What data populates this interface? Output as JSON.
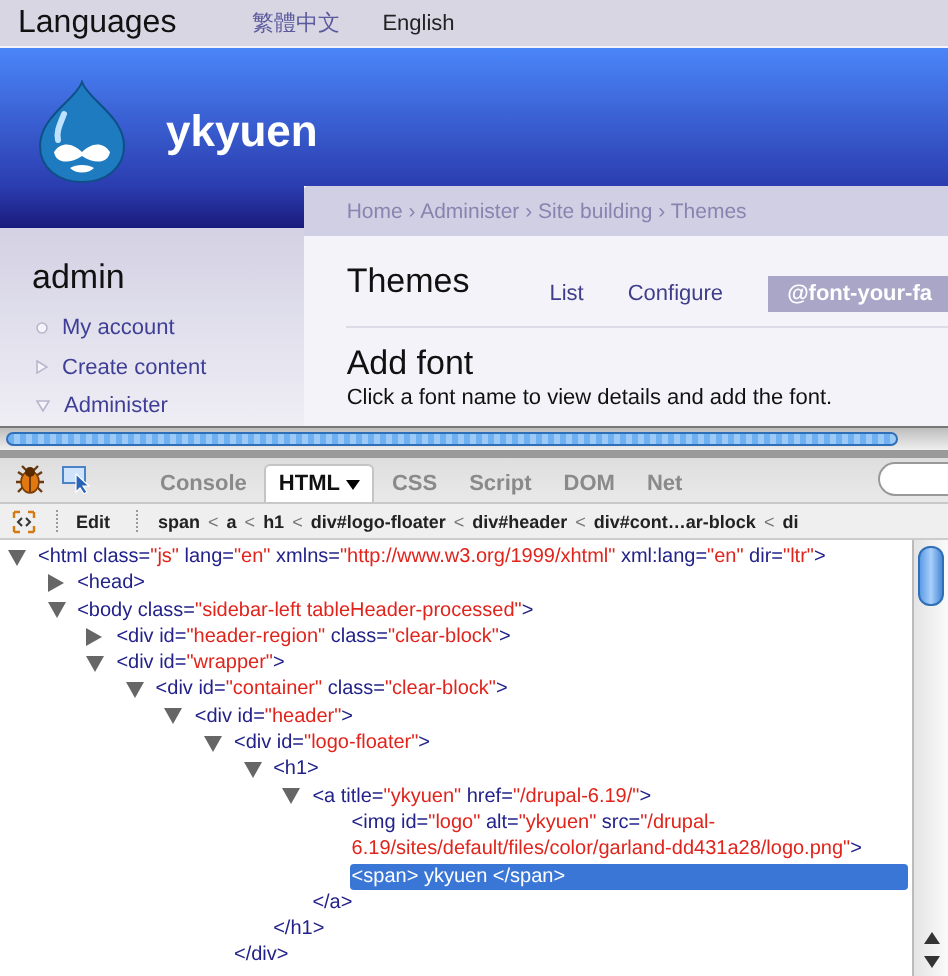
{
  "language_bar": {
    "title": "Languages",
    "links": [
      {
        "label": "繁體中文",
        "selected": false
      },
      {
        "label": "English",
        "selected": true
      }
    ]
  },
  "site": {
    "name": "ykyuen"
  },
  "breadcrumb": "Home › Administer › Site building › Themes",
  "sidebar": {
    "title": "admin",
    "items": [
      {
        "label": "My account",
        "kind": "leaf"
      },
      {
        "label": "Create content",
        "kind": "collapsed"
      },
      {
        "label": "Administer",
        "kind": "expanded"
      }
    ]
  },
  "content": {
    "title": "Themes",
    "tabs": [
      {
        "label": "List",
        "selected": false
      },
      {
        "label": "Configure",
        "selected": false
      },
      {
        "label": "@font-your-fa",
        "selected": true
      }
    ],
    "heading": "Add font",
    "description": "Click a font name to view details and add the font."
  },
  "devtools": {
    "tabs": [
      {
        "label": "Console",
        "selected": false
      },
      {
        "label": "HTML",
        "selected": true
      },
      {
        "label": "CSS",
        "selected": false
      },
      {
        "label": "Script",
        "selected": false
      },
      {
        "label": "DOM",
        "selected": false
      },
      {
        "label": "Net",
        "selected": false
      }
    ],
    "edit_label": "Edit",
    "path": [
      {
        "label": "span",
        "kind": "node"
      },
      {
        "label": "<",
        "kind": "sep"
      },
      {
        "label": "a",
        "kind": "node"
      },
      {
        "label": "<",
        "kind": "sep"
      },
      {
        "label": "h1",
        "kind": "node"
      },
      {
        "label": "<",
        "kind": "sep"
      },
      {
        "label": "div#logo-floater",
        "kind": "node"
      },
      {
        "label": "<",
        "kind": "sep"
      },
      {
        "label": "div#header",
        "kind": "node"
      },
      {
        "label": "<",
        "kind": "sep"
      },
      {
        "label": "div#cont…ar-block",
        "kind": "node"
      },
      {
        "label": "<",
        "kind": "sep"
      },
      {
        "label": "di",
        "kind": "node"
      }
    ],
    "tree": [
      {
        "open": "<html class=\"js\" lang=\"en\" xmlns=\"http://www.w3.org/1999/xhtml\" xml:lang=\"en\" dir=\"ltr\">",
        "expanded": true,
        "selected": false,
        "children": [
          {
            "open": "<head>",
            "expanded": false,
            "selected": false
          },
          {
            "open": "<body class=\"sidebar-left tableHeader-processed\">",
            "expanded": true,
            "selected": false,
            "children": [
              {
                "open": "<div id=\"header-region\" class=\"clear-block\">",
                "expanded": false,
                "selected": false
              },
              {
                "open": "<div id=\"wrapper\">",
                "expanded": true,
                "selected": false,
                "children": [
                  {
                    "open": "<div id=\"container\" class=\"clear-block\">",
                    "expanded": true,
                    "selected": false,
                    "children": [
                      {
                        "open": "<div id=\"header\">",
                        "expanded": true,
                        "selected": false,
                        "children": [
                          {
                            "open": "<div id=\"logo-floater\">",
                            "expanded": true,
                            "selected": false,
                            "close": "</div>",
                            "children": [
                              {
                                "open": "<h1>",
                                "expanded": true,
                                "selected": false,
                                "close": "</h1>",
                                "children": [
                                  {
                                    "open": "<a title=\"ykyuen\" href=\"/drupal-6.19/\">",
                                    "expanded": true,
                                    "selected": false,
                                    "close": "</a>",
                                    "children": [
                                      {
                                        "open": "<img id=\"logo\" alt=\"ykyuen\" src=\"/drupal-6.19/sites/default/files/color/garland-dd431a28/logo.png\">",
                                        "selected": false
                                      },
                                      {
                                        "open": "<span> ykyuen </span>",
                                        "selected": true
                                      }
                                    ]
                                  }
                                ]
                              }
                            ]
                          }
                        ]
                      }
                    ]
                  }
                ]
              }
            ]
          }
        ]
      }
    ]
  }
}
